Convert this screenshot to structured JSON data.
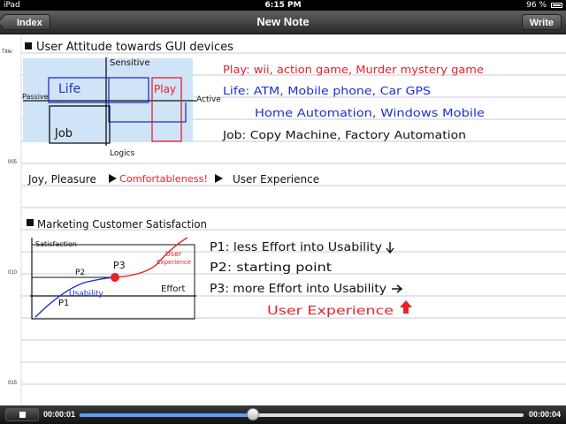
{
  "status_bar": {
    "device": "iPad",
    "time": "6:15 PM",
    "battery": "96 %"
  },
  "nav": {
    "title": "New Note",
    "back_label": "Index",
    "write_label": "Write"
  },
  "note": {
    "title_label": "Title:",
    "line_numbers": [
      "005",
      "010",
      "015"
    ],
    "heading1": "User Attitude towards GUI devices",
    "diagram1": {
      "sensitive": "Sensitive",
      "passive": "Passive",
      "active": "Active",
      "logics": "Logics",
      "life": "Life",
      "play": "Play",
      "job": "Job"
    },
    "play_line": "Play: wii, action game, Murder mystery game",
    "life_line": "Life: ATM, Mobile phone, Car GPS",
    "life_line2": "Home Automation, Windows Mobile",
    "job_line": "Job: Copy Machine, Factory Automation",
    "flow": {
      "part1": "Joy, Pleasure",
      "part2": "Comfortableness!",
      "part3": "User Experience"
    },
    "heading2": "Marketing Customer Satisfaction",
    "diagram2": {
      "ylabel": "Satisfaction",
      "xlabel": "Effort",
      "p1": "P1",
      "p2": "P2",
      "p3": "P3",
      "usability": "Usability",
      "ux1": "User",
      "ux2": "Experience"
    },
    "p1_line": "P1: less Effort into Usability",
    "p2_line": "P2: starting point",
    "p3_line": "P3: more Effort into Usability",
    "ux_line": "User Experience"
  },
  "player": {
    "current": "00:00:01",
    "total": "00:00:04",
    "progress": 0.39
  },
  "colors": {
    "ink_black": "#111111",
    "ink_red": "#e8202a",
    "ink_blue": "#1e2fd0",
    "highlight": "#cfe4f7"
  }
}
